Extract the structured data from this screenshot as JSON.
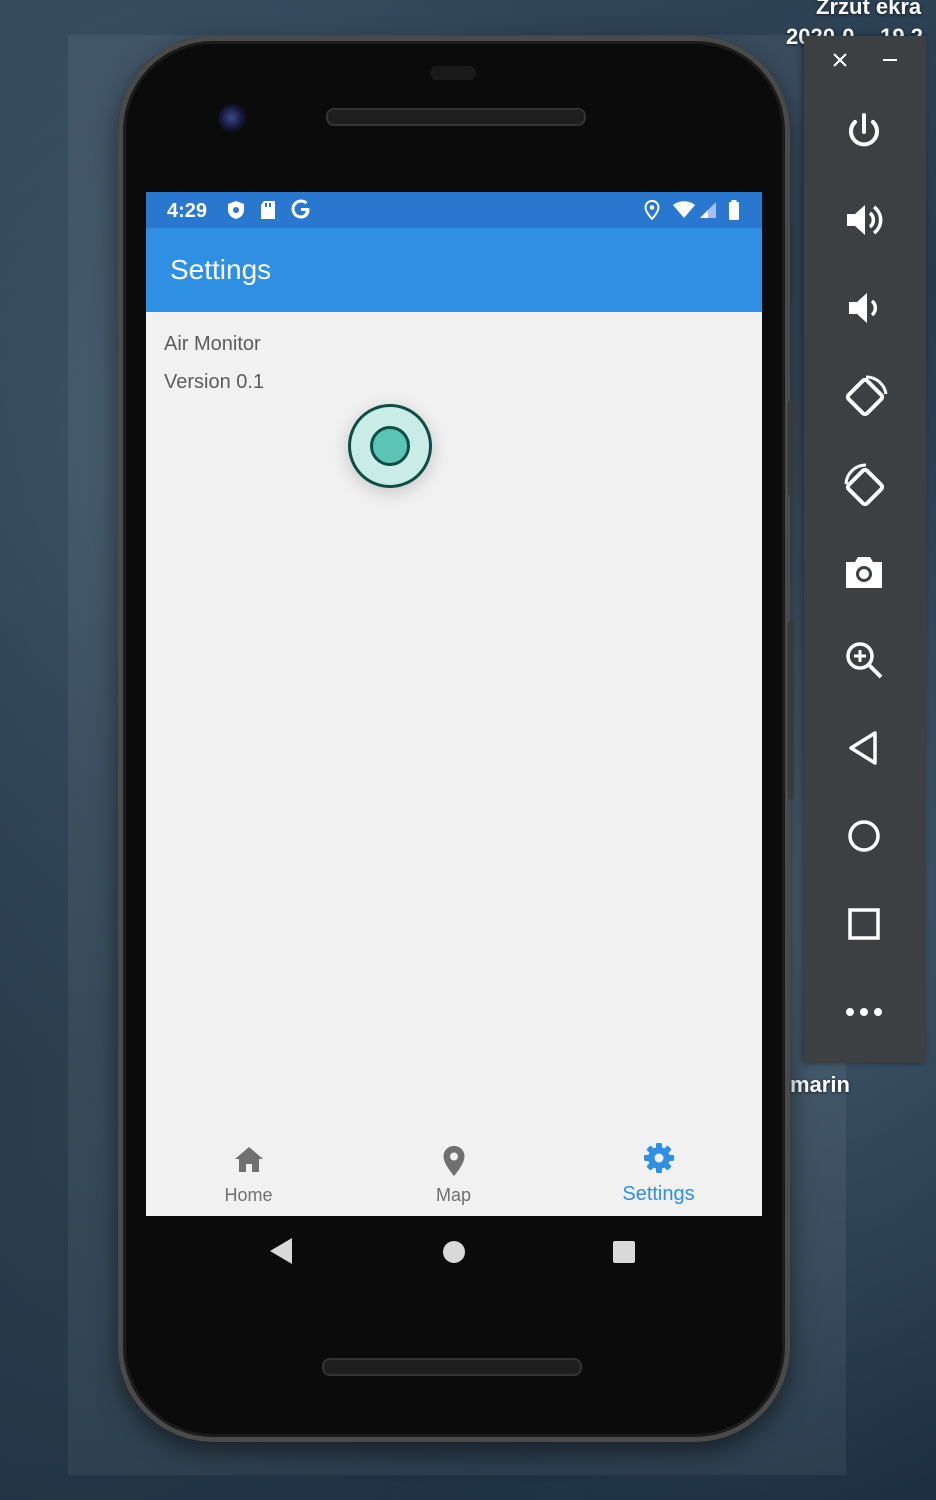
{
  "desktop": {
    "screenshot_label_line1": "Zrzut ekra",
    "screenshot_label_line2": "2020-0...-19.2",
    "folder_label": "marin"
  },
  "status_bar": {
    "time": "4:29",
    "icons": [
      "shield-icon",
      "sd-card-icon",
      "google-icon",
      "location-icon",
      "wifi-icon",
      "signal-icon",
      "battery-icon"
    ]
  },
  "app_bar": {
    "title": "Settings"
  },
  "content": {
    "app_name": "Air Monitor",
    "version": "Version 0.1"
  },
  "bottom_nav": {
    "items": [
      {
        "label": "Home",
        "icon": "home-icon",
        "active": false
      },
      {
        "label": "Map",
        "icon": "map-pin-icon",
        "active": false
      },
      {
        "label": "Settings",
        "icon": "gear-icon",
        "active": true
      }
    ]
  },
  "system_nav": [
    "back-icon",
    "home-circle-icon",
    "recents-icon"
  ],
  "emulator_toolbar": {
    "window_controls": [
      "close-icon",
      "minimize-icon"
    ],
    "buttons": [
      "power-icon",
      "volume-up-icon",
      "volume-down-icon",
      "rotate-left-icon",
      "rotate-right-icon",
      "camera-icon",
      "zoom-icon",
      "back-icon",
      "home-icon",
      "overview-icon",
      "more-icon"
    ]
  },
  "colors": {
    "status_bar": "#2a77cf",
    "app_bar": "#2e8fe3",
    "accent": "#2e8fe3",
    "screen_bg": "#f1f1f1",
    "inactive_nav": "#707070"
  }
}
